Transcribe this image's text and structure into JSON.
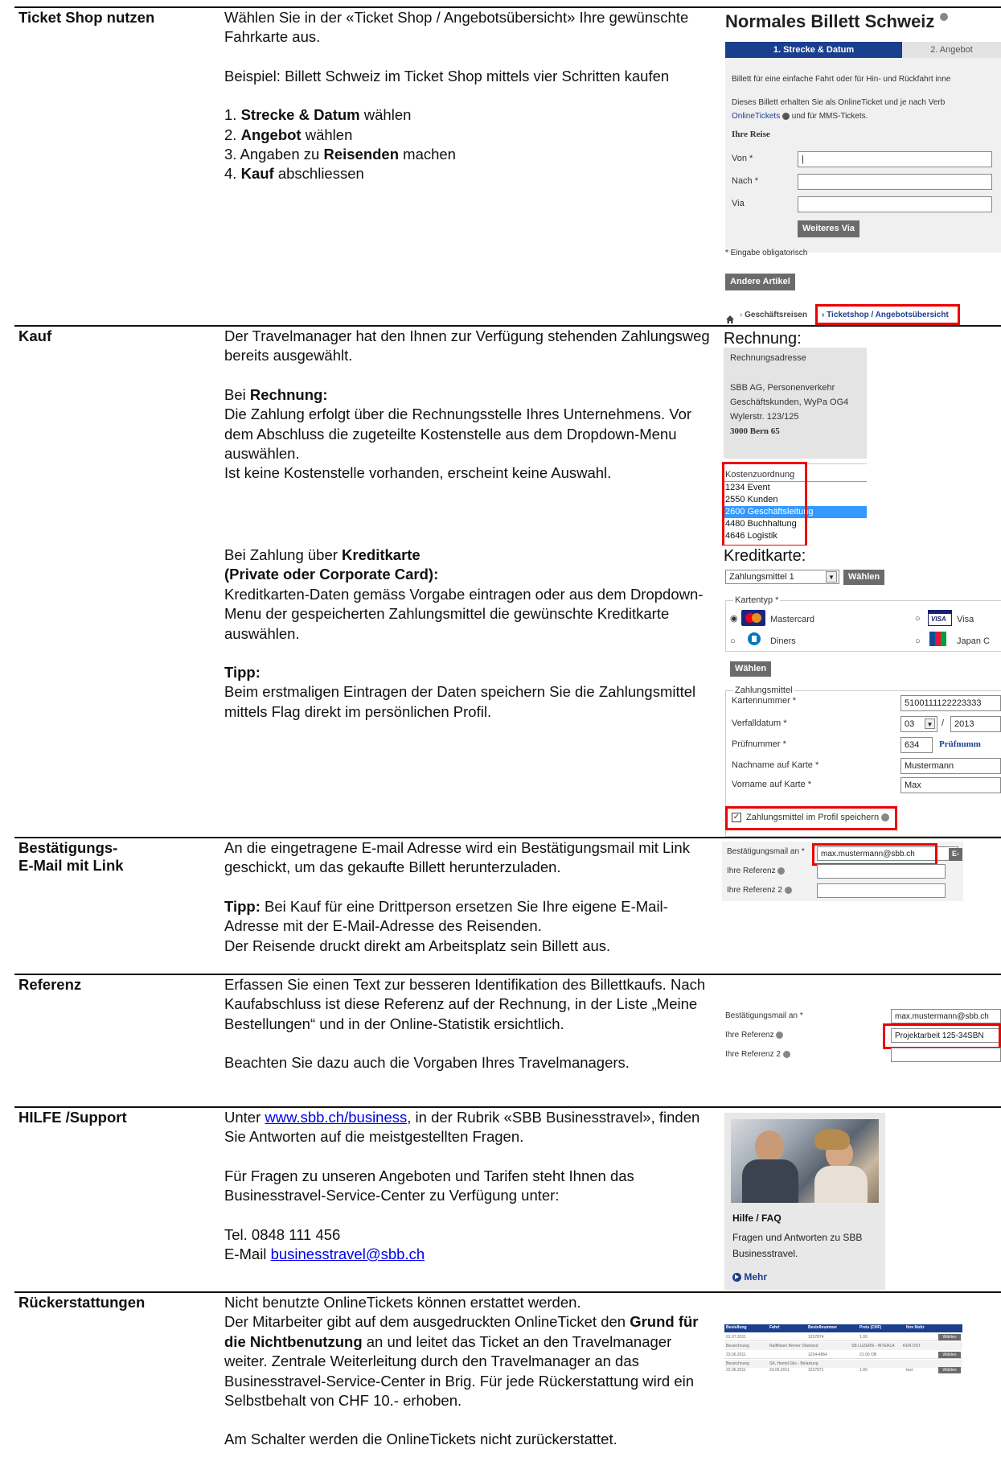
{
  "rows": [
    {
      "label": "Ticket Shop nutzen",
      "texts": [
        "Wählen Sie in der «Ticket Shop / Angebotsübersicht» Ihre gewünschte Fahrkarte aus.",
        "Beispiel: Billett Schweiz im Ticket Shop mittels vier Schritten kaufen"
      ],
      "steps": [
        {
          "num": "1.",
          "bold": "Strecke & Datum",
          "rest": " wählen"
        },
        {
          "num": "2.",
          "bold": "Angebot",
          "rest": " wählen"
        },
        {
          "num": "3.",
          "pre": " Angaben zu ",
          "bold": "Reisenden",
          "rest": " machen"
        },
        {
          "num": "4.",
          "bold": "Kauf",
          "rest": " abschliessen"
        }
      ]
    },
    {
      "label": "Kauf",
      "intro": "Der Travelmanager hat den Ihnen zur Verfügung stehenden Zahlungsweg bereits ausgewählt.",
      "rechnung_pre": "Bei ",
      "rechnung_bold": "Rechnung:",
      "rechnung_text": "Die Zahlung erfolgt über die Rechnungsstelle Ihres Unternehmens. Vor dem Abschluss die zugeteilte Kostenstelle aus dem Dropdown-Menu auswählen.",
      "rechnung_text2": "Ist keine Kostenstelle vorhanden, erscheint keine Auswahl.",
      "kredit_pre": "Bei Zahlung über ",
      "kredit_bold": "Kreditkarte",
      "kredit_bold2": "(Private oder Corporate Card):",
      "kredit_text": "Kreditkarten-Daten gemäss Vorgabe eintragen oder aus dem Dropdown-Menu der gespeicherten Zahlungsmittel die gewünschte Kreditkarte auswählen.",
      "tipp_label": "Tipp:",
      "tipp_text": "Beim erstmaligen Eintragen der Daten speichern Sie die Zahlungsmittel mittels Flag direkt im persönlichen Profil."
    },
    {
      "label": "Bestätigungs-",
      "label2": "E-Mail mit Link",
      "text": "An die eingetragene E-mail Adresse wird ein Bestätigungsmail mit Link geschickt, um das gekaufte Billett herunterzuladen.",
      "tipp_label": "Tipp:",
      "tipp_text": " Bei Kauf für eine Drittperson ersetzen Sie Ihre eigene E-Mail-Adresse mit der E-Mail-Adresse des Reisenden.",
      "tipp_text2": "Der Reisende druckt direkt am Arbeitsplatz sein Billett aus."
    },
    {
      "label": "Referenz",
      "text": "Erfassen Sie einen Text zur besseren Identifikation des Billettkaufs. Nach Kaufabschluss ist diese Referenz auf der Rechnung, in der Liste „Meine Bestellungen“ und in der Online-Statistik ersichtlich.",
      "text2": "Beachten Sie dazu auch die Vorgaben Ihres Travelmanagers."
    },
    {
      "label": "HILFE /Support",
      "pre": "Unter ",
      "link": "www.sbb.ch/business",
      "post": ", in der Rubrik «SBB Businesstravel», finden Sie Antworten auf die meistgestellten Fragen.",
      "text2": "Für Fragen zu unseren Angeboten und Tarifen steht Ihnen das Businesstravel-Service-Center zu Verfügung unter:",
      "tel": "Tel. 0848 111 456",
      "mail_pre": "E-Mail ",
      "mail": "businesstravel@sbb.ch"
    },
    {
      "label": "Rückerstattungen",
      "t1": "Nicht benutzte OnlineTickets können erstattet werden.",
      "t2": "Der Mitarbeiter gibt auf dem ausgedruckten OnlineTicket den ",
      "t2b": "Grund für die Nichtbenutzung",
      "t2c": " an und leitet das Ticket an den Travelmanager weiter. Zentrale Weiterleitung durch den Travelmanager an das Businesstravel-Service-Center in Brig. Für jede Rückerstattung wird ein Selbstbehalt von CHF 10.- erhoben.",
      "t3": "Am Schalter werden die OnlineTickets nicht zurückerstattet."
    }
  ],
  "shot_ticket": {
    "title": "Normales Billett Schweiz",
    "step1": "1. Strecke & Datum",
    "step2": "2. Angebot",
    "desc1": "Billett für eine einfache Fahrt oder für Hin- und Rückfahrt inne",
    "desc2": "Dieses Billett erhalten Sie als OnlineTicket und je nach Verb",
    "desc3a": "OnlineTickets",
    "desc3b": "und für MMS-Tickets.",
    "section": "Ihre Reise",
    "von": "Von *",
    "nach": "Nach *",
    "via": "Via",
    "weiteres_via": "Weiteres Via",
    "required": "* Eingabe obligatorisch",
    "andere": "Andere Artikel",
    "crumb1": "Geschäftsreisen",
    "crumb2": "Ticketshop / Angebotsübersicht"
  },
  "shot_rechnung": {
    "heading": "Rechnung:",
    "addr_label": "Rechnungsadresse",
    "addr1": "SBB AG, Personenverkehr",
    "addr2": "Geschäftskunden, WyPa OG4",
    "addr3": "Wylerstr. 123/125",
    "addr4": "3000 Bern 65",
    "kosten_label": "Kostenzuordnung",
    "options": [
      "1234 Event",
      "2550 Kunden",
      "2600 Geschäftsleitung",
      "4480 Buchhaltung",
      "4646 Logistik"
    ],
    "selected_index": 2
  },
  "shot_kredit": {
    "heading": "Kreditkarte:",
    "select_value": "Zahlungsmittel 1",
    "waehlen": "Wählen",
    "kartentyp": "Kartentyp *",
    "mastercard": "Mastercard",
    "visa": "Visa",
    "diners": "Diners",
    "japan": "Japan C",
    "waehlen2": "Wählen",
    "zm_label": "Zahlungsmittel",
    "kartennummer_label": "Kartennummer *",
    "kartennummer": "5100111122223333",
    "verfall_label": "Verfalldatum *",
    "monat": "03",
    "jahr": "2013",
    "pruef_label": "Prüfnummer *",
    "pruef": "634",
    "pruef_link": "Prüfnumm",
    "nachname_label": "Nachname auf Karte *",
    "nachname": "Mustermann",
    "vorname_label": "Vorname auf Karte *",
    "vorname": "Max",
    "save_label": "Zahlungsmittel im Profil speichern"
  },
  "shot_mail": {
    "label1": "Bestätigungsmail an *",
    "value1": "max.mustermann@sbb.ch",
    "label2": "Ihre Referenz",
    "label3": "Ihre Referenz 2",
    "btn": "E-"
  },
  "shot_ref": {
    "label1": "Bestätigungsmail an *",
    "value1": "max.mustermann@sbb.ch",
    "label2": "Ihre Referenz",
    "value2": "Projektarbeit 125-34SBN",
    "label3": "Ihre Referenz 2"
  },
  "shot_help": {
    "title": "Hilfe / FAQ",
    "text": "Fragen und Antworten zu SBB Businesstravel.",
    "more": "Mehr"
  },
  "shot_table": {
    "headers": [
      "Bestellung",
      "Fahrt",
      "Bestellnummer",
      "Preis (CHF)",
      "Ihre Notiz"
    ],
    "rows": [
      [
        "01.07.2011",
        "",
        "1237874",
        "1.00",
        ""
      ],
      [
        "Bezeichnung",
        "Raiffeisen Berner Oberland",
        "SB LUZERN - INTERLA",
        "KEN OST",
        ""
      ],
      [
        "23.06.2011",
        "",
        "1234-4864",
        "21.00 OB",
        ""
      ],
      [
        "Bezeichnung",
        "SA, Hamid Glis - Belastung",
        "",
        "",
        ""
      ],
      [
        "22.06.2011",
        "23.06.2011",
        "1237871",
        "1.00",
        "test"
      ]
    ],
    "btn": "Wählen"
  }
}
